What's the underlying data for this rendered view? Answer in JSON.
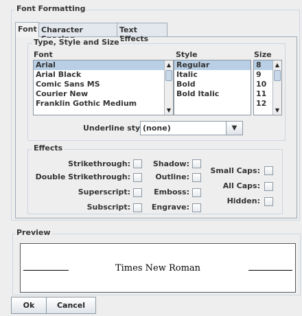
{
  "title": "Font Formatting",
  "tabs": [
    {
      "label": "Font"
    },
    {
      "label": "Character Spacing"
    },
    {
      "label": "Text Effects"
    }
  ],
  "type_group": {
    "title": "Type, Style and Size",
    "font_header": "Font",
    "style_header": "Style",
    "size_header": "Size",
    "fonts": [
      "Arial",
      "Arial Black",
      "Comic Sans MS",
      "Courier New",
      "Franklin Gothic Medium"
    ],
    "styles": [
      "Regular",
      "Italic",
      "Bold",
      "Bold Italic"
    ],
    "sizes": [
      "8",
      "9",
      "10",
      "11",
      "12"
    ],
    "selected_font": "Arial",
    "selected_style": "Regular",
    "selected_size": "8"
  },
  "underline": {
    "label": "Underline style",
    "value": "(none)"
  },
  "effects": {
    "title": "Effects",
    "col1": [
      "Strikethrough:",
      "Double Strikethrough:",
      "Superscript:",
      "Subscript:"
    ],
    "col2": [
      "Shadow:",
      "Outline:",
      "Emboss:",
      "Engrave:"
    ],
    "col3": [
      "Small Caps:",
      "All Caps:",
      "Hidden:"
    ]
  },
  "preview": {
    "title": "Preview",
    "sample_text": "Times New Roman"
  },
  "buttons": {
    "ok": "Ok",
    "cancel": "Cancel"
  },
  "colors": {
    "selection": "#b8cfe5",
    "panel": "#eeeeee",
    "border": "#8c97a2"
  }
}
